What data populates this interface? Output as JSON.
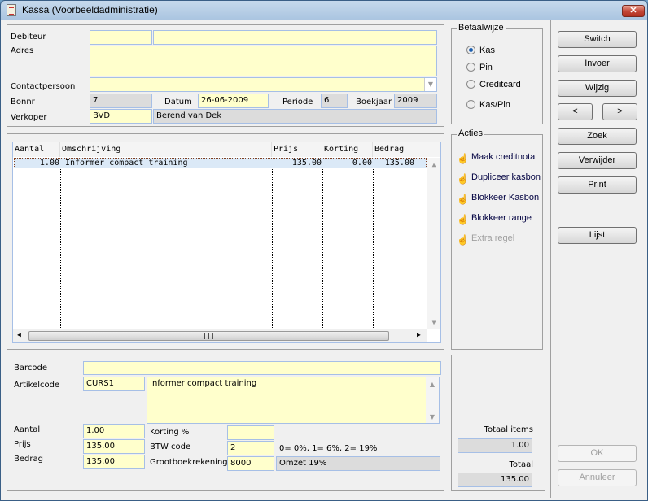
{
  "window": {
    "title": "Kassa (Voorbeeldadministratie)",
    "close": "✕"
  },
  "header": {
    "debiteur_label": "Debiteur",
    "debiteur_code": "",
    "debiteur_name": "",
    "adres_label": "Adres",
    "adres": "",
    "contact_label": "Contactpersoon",
    "contact": "",
    "bonnr_label": "Bonnr",
    "bonnr": "7",
    "datum_label": "Datum",
    "datum": "26-06-2009",
    "periode_label": "Periode",
    "periode": "6",
    "boekjaar_label": "Boekjaar",
    "boekjaar": "2009",
    "verkoper_label": "Verkoper",
    "verkoper_code": "BVD",
    "verkoper_name": "Berend van Dek"
  },
  "table": {
    "columns": [
      "Aantal",
      "Omschrijving",
      "Prijs",
      "Korting",
      "Bedrag"
    ],
    "rows": [
      {
        "aantal": "1.00",
        "omschrijving": "Informer compact training",
        "prijs": "135.00",
        "korting": "0.00",
        "bedrag": "135.00"
      }
    ]
  },
  "detail": {
    "barcode_label": "Barcode",
    "barcode": "",
    "artikelcode_label": "Artikelcode",
    "artikelcode": "CURS1",
    "artikel_desc": "Informer compact training",
    "aantal_label": "Aantal",
    "aantal": "1.00",
    "prijs_label": "Prijs",
    "prijs": "135.00",
    "bedrag_label": "Bedrag",
    "bedrag": "135.00",
    "korting_label": "Korting %",
    "korting": "",
    "btw_label": "BTW code",
    "btw": "2",
    "btw_hint": "0= 0%, 1= 6%, 2= 19%",
    "grootboek_label": "Grootboekrekening",
    "grootboek": "8000",
    "grootboek_name": "Omzet 19%"
  },
  "betaalwijze": {
    "title": "Betaalwijze",
    "options": [
      "Kas",
      "Pin",
      "Creditcard",
      "Kas/Pin"
    ],
    "selected": "Kas"
  },
  "acties": {
    "title": "Acties",
    "items": [
      "Maak creditnota",
      "Dupliceer kasbon",
      "Blokkeer Kasbon",
      "Blokkeer range",
      "Extra regel"
    ]
  },
  "totals": {
    "items_label": "Totaal items",
    "items": "1.00",
    "total_label": "Totaal",
    "total": "135.00"
  },
  "buttons": {
    "switch": "Switch",
    "invoer": "Invoer",
    "wijzig": "Wijzig",
    "prev": "<",
    "next": ">",
    "zoek": "Zoek",
    "verwijder": "Verwijder",
    "print": "Print",
    "lijst": "Lijst",
    "ok": "OK",
    "annuleer": "Annuleer"
  },
  "colors": {
    "field_bg": "#ffffcc",
    "field_border": "#a6bfe6",
    "readonly_bg": "#dcdcdc",
    "selected_row": "#dbe9f7"
  }
}
